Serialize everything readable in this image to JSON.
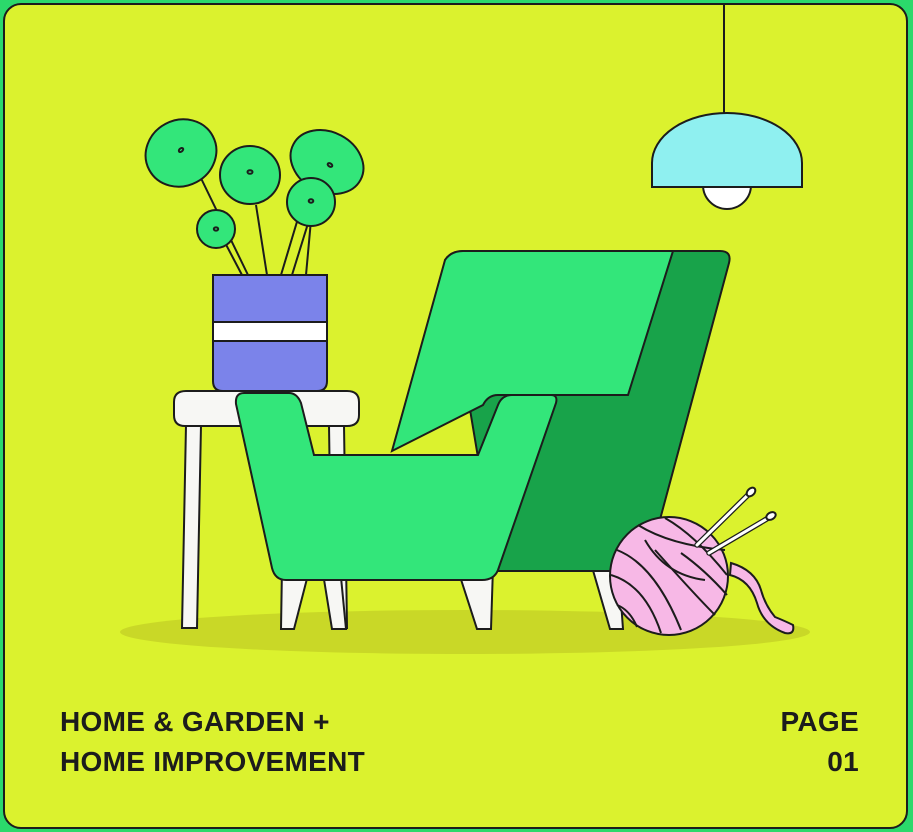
{
  "category": {
    "line1": "HOME & GARDEN +",
    "line2": "HOME IMPROVEMENT"
  },
  "page": {
    "label": "PAGE",
    "number": "01"
  },
  "colors": {
    "page_background": "#2bd96b",
    "card_background": "#dbf22e",
    "outline": "#1c1c1c",
    "armchair_front": "#33e67a",
    "armchair_side": "#18a34a",
    "leaves": "#33e67a",
    "vase": "#7b83ea",
    "lamp_shade": "#8ff0f0",
    "yarn": "#f7b8e6",
    "table": "#f7f7f4",
    "floor_shadow": "#c9d827"
  },
  "illustration": {
    "items": [
      "armchair-icon",
      "potted-plant-icon",
      "side-table-icon",
      "pendant-lamp-icon",
      "yarn-ball-icon",
      "knitting-needles-icon"
    ]
  }
}
